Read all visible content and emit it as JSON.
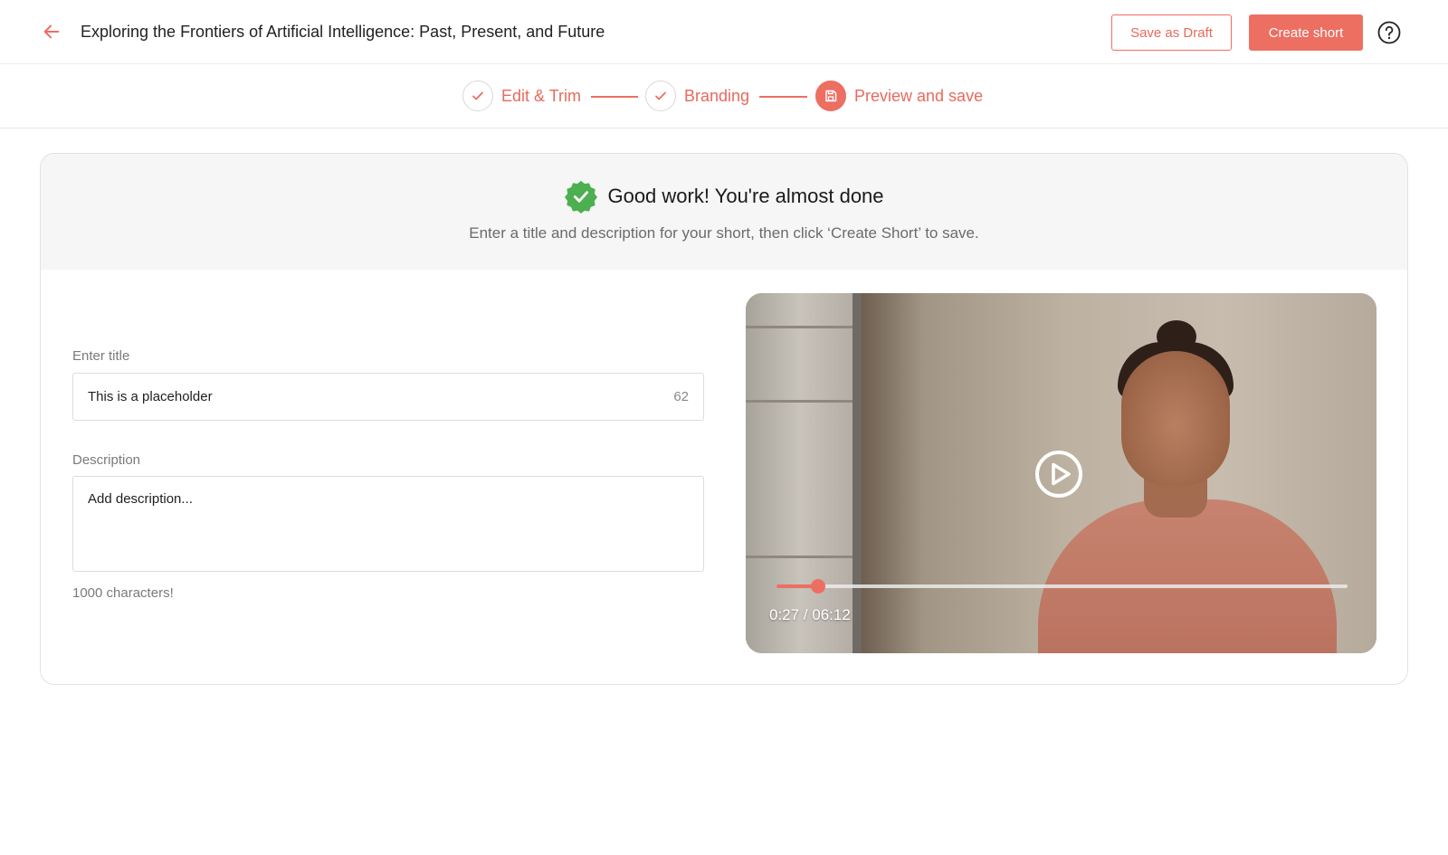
{
  "header": {
    "title": "Exploring the Frontiers of Artificial Intelligence: Past, Present, and Future",
    "save_draft_label": "Save as Draft",
    "create_short_label": "Create short"
  },
  "stepper": {
    "steps": [
      {
        "label": "Edit & Trim",
        "state": "done",
        "icon": "check-icon"
      },
      {
        "label": "Branding",
        "state": "done",
        "icon": "check-icon"
      },
      {
        "label": "Preview and save",
        "state": "active",
        "icon": "save-icon"
      }
    ]
  },
  "banner": {
    "title": "Good work! You're almost done",
    "subtitle": "Enter a title and description for your short, then click ‘Create Short’ to save."
  },
  "form": {
    "title_label": "Enter title",
    "title_value": "This is a placeholder",
    "title_char_count": "62",
    "description_label": "Description",
    "description_placeholder": "Add description...",
    "description_limit": "1000 characters!"
  },
  "video": {
    "time": "0:27 / 06:12",
    "progress": 0.0726
  },
  "colors": {
    "accent": "#ec6f62",
    "success": "#4caf50"
  }
}
